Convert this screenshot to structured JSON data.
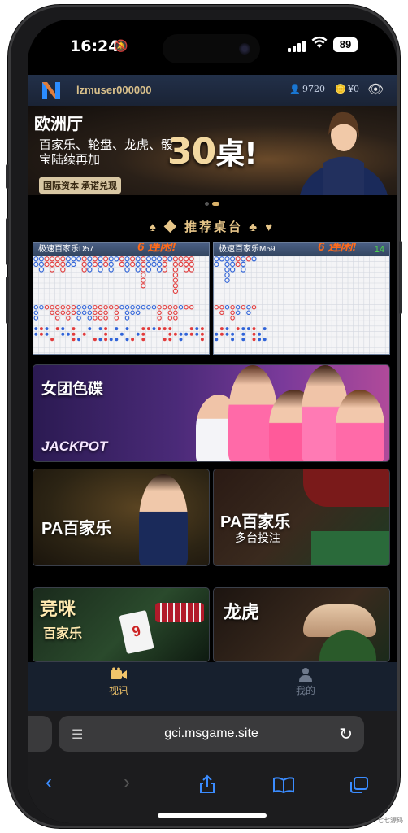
{
  "status_bar": {
    "time": "16:24",
    "battery": "89"
  },
  "header": {
    "username": "lzmuser000000",
    "stat1": "9720",
    "stat2": "¥0"
  },
  "banner": {
    "title": "欧洲厅",
    "subtitle": "百家乐、轮盘、龙虎、骰宝陆续再加",
    "big": "30",
    "big_suffix": "桌!",
    "tag": "国际资本 承诺兑现"
  },
  "section_title": "♠ ◆ 推荐桌台 ♣ ♥",
  "roads": [
    {
      "name": "极速百家乐D57",
      "streak": "6 连闲!",
      "count": ""
    },
    {
      "name": "极速百家乐M59",
      "streak": "6 连闲!",
      "count": "14"
    }
  ],
  "tiles": {
    "girls": {
      "title": "女团色碟",
      "sub": "JACKPOT"
    },
    "pa1": {
      "title": "PA百家乐"
    },
    "pa2": {
      "title": "PA百家乐",
      "sub": "多台投注"
    },
    "squeeze": {
      "title": "竞咪",
      "sub": "百家乐"
    },
    "dragon": {
      "title": "龙虎"
    }
  },
  "tabbar": {
    "video": "视讯",
    "mine": "我的"
  },
  "safari": {
    "url": "gci.msgame.site"
  },
  "watermark": "七七源码",
  "colors": {
    "gold": "#e7c689",
    "banker": "#e23b3b",
    "player": "#2f63d8",
    "tie": "#3aaa3a"
  }
}
